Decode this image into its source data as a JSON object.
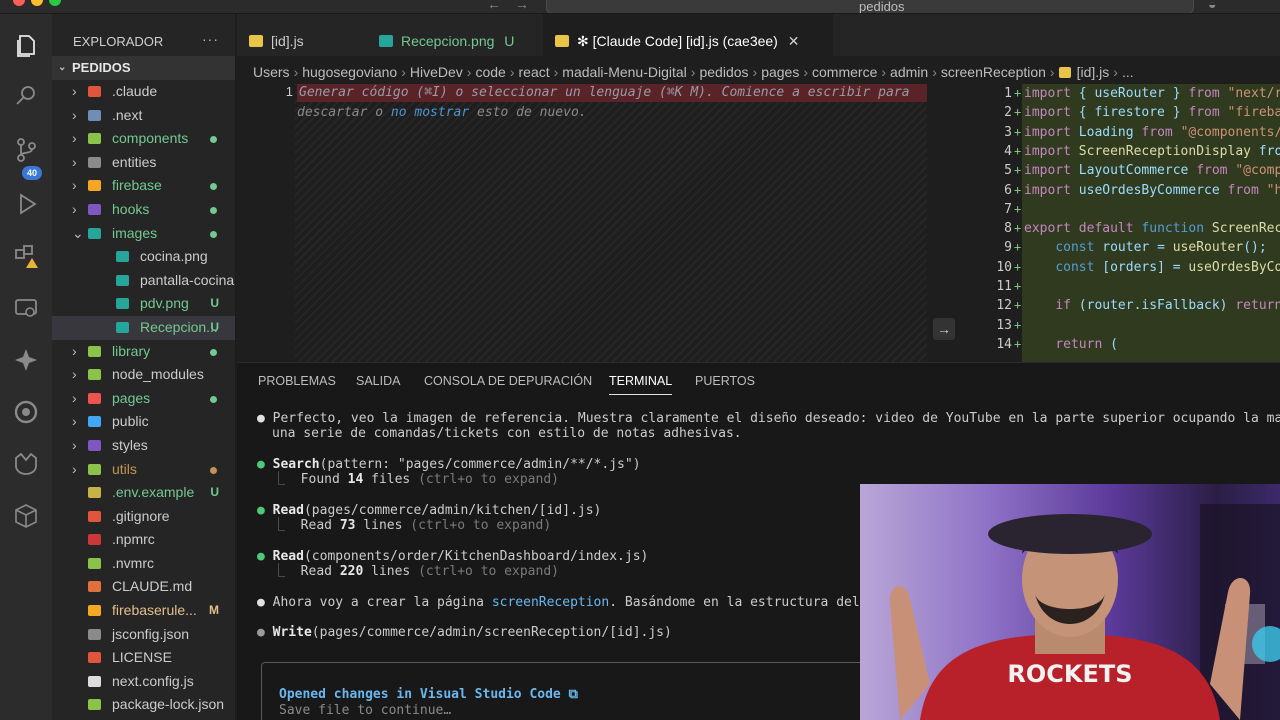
{
  "titlebar": {
    "search_label": "pedidos"
  },
  "activity": {
    "source_control_badge": "40"
  },
  "sidebar": {
    "title": "EXPLORADOR",
    "more": "···",
    "root": "PEDIDOS",
    "items": [
      {
        "name": ".claude",
        "status": "",
        "dot": "",
        "color": "#e2553d",
        "folder": true,
        "indent": 0
      },
      {
        "name": ".next",
        "status": "",
        "dot": "",
        "color": "#6d8fb5",
        "folder": true,
        "indent": 0
      },
      {
        "name": "components",
        "status": "",
        "dot": "#73c991",
        "color": "#8bc34a",
        "folder": true,
        "indent": 0
      },
      {
        "name": "entities",
        "status": "",
        "dot": "",
        "color": "#8a8a8a",
        "folder": true,
        "indent": 0
      },
      {
        "name": "firebase",
        "status": "",
        "dot": "#73c991",
        "color": "#f5a623",
        "folder": true,
        "indent": 0
      },
      {
        "name": "hooks",
        "status": "",
        "dot": "#73c991",
        "color": "#7e57c2",
        "folder": true,
        "indent": 0
      },
      {
        "name": "images",
        "status": "",
        "dot": "#73c991",
        "color": "#26a69a",
        "folder": true,
        "indent": 0,
        "open": true
      },
      {
        "name": "cocina.png",
        "status": "",
        "dot": "",
        "color": "#26a69a",
        "folder": false,
        "indent": 1
      },
      {
        "name": "pantalla-cocina...",
        "status": "",
        "dot": "",
        "color": "#26a69a",
        "folder": false,
        "indent": 1
      },
      {
        "name": "pdv.png",
        "status": "U",
        "dot": "",
        "color": "#26a69a",
        "folder": false,
        "indent": 1
      },
      {
        "name": "Recepcion...",
        "status": "U",
        "dot": "",
        "color": "#26a69a",
        "folder": false,
        "indent": 1,
        "selected": true
      },
      {
        "name": "library",
        "status": "",
        "dot": "#73c991",
        "color": "#8bc34a",
        "folder": true,
        "indent": 0
      },
      {
        "name": "node_modules",
        "status": "",
        "dot": "",
        "color": "#8bc34a",
        "folder": true,
        "indent": 0
      },
      {
        "name": "pages",
        "status": "",
        "dot": "#73c991",
        "color": "#ef5350",
        "folder": true,
        "indent": 0
      },
      {
        "name": "public",
        "status": "",
        "dot": "",
        "color": "#42a5f5",
        "folder": true,
        "indent": 0
      },
      {
        "name": "styles",
        "status": "",
        "dot": "",
        "color": "#7e57c2",
        "folder": true,
        "indent": 0
      },
      {
        "name": "utils",
        "status": "",
        "dot": "#c09553",
        "color": "#8bc34a",
        "folder": true,
        "indent": 0
      },
      {
        "name": ".env.example",
        "status": "U",
        "dot": "",
        "color": "#c7b24a",
        "folder": false,
        "indent": 0
      },
      {
        "name": ".gitignore",
        "status": "",
        "dot": "",
        "color": "#e2553d",
        "folder": false,
        "indent": 0
      },
      {
        "name": ".npmrc",
        "status": "",
        "dot": "",
        "color": "#cb3837",
        "folder": false,
        "indent": 0
      },
      {
        "name": ".nvmrc",
        "status": "",
        "dot": "",
        "color": "#8bc34a",
        "folder": false,
        "indent": 0
      },
      {
        "name": "CLAUDE.md",
        "status": "",
        "dot": "",
        "color": "#e2703d",
        "folder": false,
        "indent": 0
      },
      {
        "name": "firebaserule...",
        "status": "M",
        "dot": "",
        "color": "#f5a623",
        "folder": false,
        "indent": 0
      },
      {
        "name": "jsconfig.json",
        "status": "",
        "dot": "",
        "color": "#8a8a8a",
        "folder": false,
        "indent": 0
      },
      {
        "name": "LICENSE",
        "status": "",
        "dot": "",
        "color": "#e2553d",
        "folder": false,
        "indent": 0
      },
      {
        "name": "next.config.js",
        "status": "",
        "dot": "",
        "color": "#dddddd",
        "folder": false,
        "indent": 0
      },
      {
        "name": "package-lock.json",
        "status": "",
        "dot": "",
        "color": "#8bc34a",
        "folder": false,
        "indent": 0
      }
    ]
  },
  "tabs": [
    {
      "label": "[id].js",
      "suffix": "",
      "color": "#e8c547",
      "active": false
    },
    {
      "label": "Recepcion.png",
      "suffix": "U",
      "color": "#26a69a",
      "active": false
    },
    {
      "label": "✻ [Claude Code] [id].js (cae3ee)",
      "suffix": "",
      "color": "#e8c547",
      "active": true
    }
  ],
  "breadcrumb": [
    "Users",
    "hugosegoviano",
    "HiveDev",
    "code",
    "react",
    "madali-Menu-Digital",
    "pedidos",
    "pages",
    "commerce",
    "admin",
    "screenReception",
    "[id].js",
    "..."
  ],
  "editor": {
    "line_number": "1",
    "hint_line1": "Generar código (⌘I) o seleccionar un lenguaje (⌘K M). Comience a escribir para",
    "hint_line2_a": "descartar o ",
    "hint_line2_link": "no mostrar",
    "hint_line2_b": " esto de nuevo."
  },
  "diff": {
    "lines": [
      "1",
      "2",
      "3",
      "4",
      "5",
      "6",
      "7",
      "8",
      "9",
      "10",
      "11",
      "12",
      "13",
      "14"
    ],
    "code": [
      "import { useRouter } from \"next/r",
      "import { firestore } from \"fireba",
      "import Loading from \"@components/",
      "import ScreenReceptionDisplay fro",
      "import LayoutCommerce from \"@comp",
      "import useOrdesByCommerce from \"h",
      "",
      "export default function ScreenRec",
      "    const router = useRouter();",
      "    const [orders] = useOrdesByCo",
      "",
      "    if (router.isFallback) return",
      "",
      "    return ("
    ]
  },
  "panel": {
    "tabs": [
      "PROBLEMAS",
      "SALIDA",
      "CONSOLA DE DEPURACIÓN",
      "TERMINAL",
      "PUERTOS"
    ],
    "active_tab": "TERMINAL"
  },
  "terminal": {
    "msg1_l1": "Perfecto, veo la imagen de referencia. Muestra claramente el diseño deseado: video de YouTube en la parte superior ocupando la mayor parte de",
    "msg1_l2": "una serie de comandas/tickets con estilo de notas adhesivas.",
    "search_tool": "Search",
    "search_args": "(pattern: \"pages/commerce/admin/**/*.js\")",
    "search_result": "Found ",
    "search_count": "14",
    "search_result2": " files",
    "expand_hint": "(ctrl+o to expand)",
    "read1_tool": "Read",
    "read1_args": "(pages/commerce/admin/kitchen/[id].js)",
    "read1_result": "Read ",
    "read1_count": "73",
    "read1_result2": " lines",
    "read2_tool": "Read",
    "read2_args": "(components/order/KitchenDashboard/index.js)",
    "read2_result": "Read ",
    "read2_count": "220",
    "read2_result2": " lines",
    "msg2_a": "Ahora voy a crear la página ",
    "msg2_link": "screenReception",
    "msg2_b": ". Basándome en la estructura del proyecto",
    "write_tool": "Write",
    "write_args": "(pages/commerce/admin/screenReception/[id].js)",
    "box_title": "Opened changes in Visual Studio Code ⧉",
    "box_sub": "Save file to continue…"
  },
  "webcam": {
    "shirt_text": "ROCKETS"
  }
}
